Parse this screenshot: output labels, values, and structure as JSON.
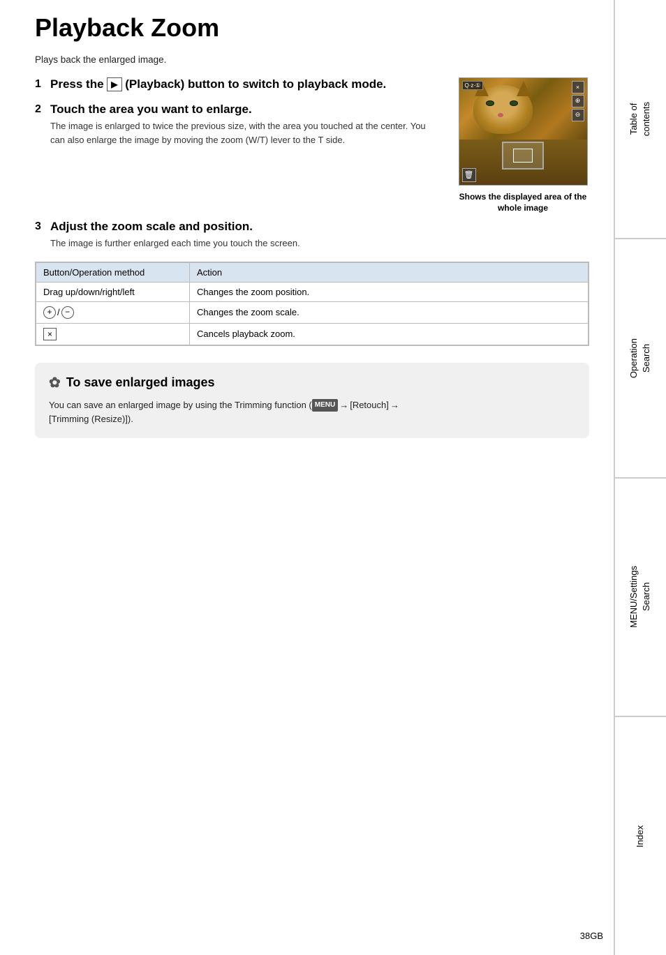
{
  "page": {
    "title": "Playback Zoom",
    "intro": "Plays back the enlarged image.",
    "page_number": "38GB"
  },
  "steps": [
    {
      "number": "1",
      "heading": "Press the  (Playback) button to switch to playback mode.",
      "detail": ""
    },
    {
      "number": "2",
      "heading": "Touch the area you want to enlarge.",
      "detail": "The image is enlarged to twice the previous size, with the area you touched at the center. You can also enlarge the image by moving the zoom (W/T) lever to the T side."
    },
    {
      "number": "3",
      "heading": "Adjust the zoom scale and position.",
      "detail": "The image is further enlarged each time you touch the screen."
    }
  ],
  "image_caption": "Shows the displayed area of the whole image",
  "table": {
    "headers": [
      "Button/Operation method",
      "Action"
    ],
    "rows": [
      {
        "method": "Drag up/down/right/left",
        "action": "Changes the zoom position."
      },
      {
        "method": "zoom_icon",
        "action": "Changes the zoom scale."
      },
      {
        "method": "x_icon",
        "action": "Cancels playback zoom."
      }
    ]
  },
  "tip": {
    "icon": "✿",
    "heading": "To save enlarged images",
    "text": "You can save an enlarged image by using the Trimming function (",
    "menu_label": "MENU",
    "arrow1": "→",
    "retouch": "[Retouch]",
    "arrow2": "→",
    "trimming": "[Trimming (Resize)]",
    "end": ")."
  },
  "sidebar": {
    "sections": [
      {
        "id": "table-of-contents",
        "label": "Table of\ncontents"
      },
      {
        "id": "operation-search",
        "label": "Operation\nSearch"
      },
      {
        "id": "menu-settings-search",
        "label": "MENU/Settings\nSearch"
      },
      {
        "id": "index",
        "label": "Index"
      }
    ]
  },
  "ui": {
    "badge_label": "Q·z·①",
    "plus_icon": "+",
    "minus_icon": "−",
    "x_icon": "×",
    "trash_icon": "🗑",
    "playback_icon": "▶"
  }
}
